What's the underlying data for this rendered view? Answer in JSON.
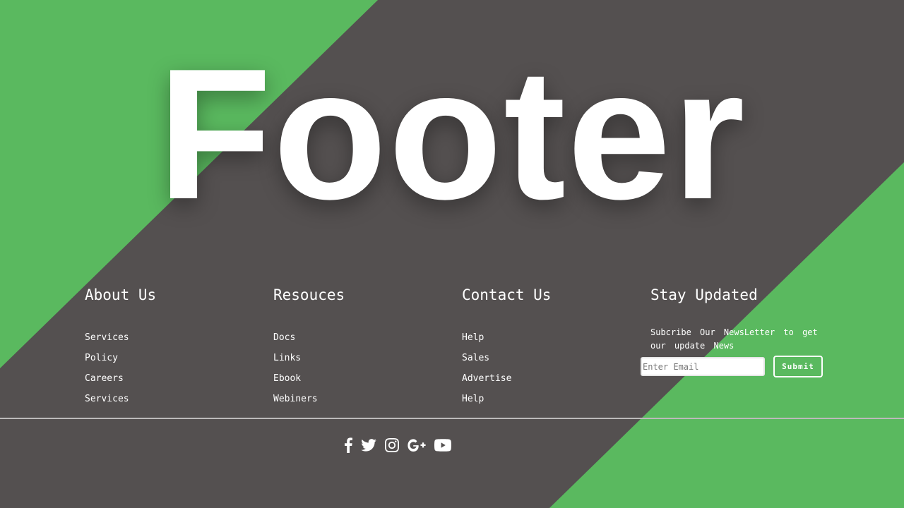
{
  "hero": {
    "title": "Footer"
  },
  "columns": [
    {
      "heading": "About Us",
      "links": [
        "Services",
        "Policy",
        "Careers",
        "Services"
      ]
    },
    {
      "heading": "Resouces",
      "links": [
        "Docs",
        "Links",
        "Ebook",
        "Webiners"
      ]
    },
    {
      "heading": "Contact Us",
      "links": [
        "Help",
        "Sales",
        "Advertise",
        "Help"
      ]
    }
  ],
  "newsletter": {
    "heading": "Stay Updated",
    "text": "Subcribe Our NewsLetter to get our update News",
    "email_placeholder": "Enter Email",
    "email_value": "",
    "submit_label": "Submit"
  },
  "social": [
    "facebook-icon",
    "twitter-icon",
    "instagram-icon",
    "google-plus-icon",
    "youtube-icon"
  ],
  "colors": {
    "accent": "#5ab95f",
    "background": "#545050",
    "text": "#ffffff"
  }
}
